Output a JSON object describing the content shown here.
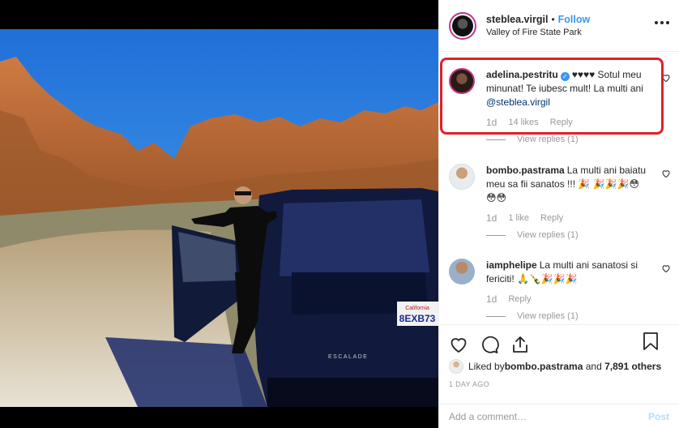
{
  "header": {
    "username": "steblea.virgil",
    "separator": "•",
    "follow_label": "Follow",
    "location": "Valley of Fire State Park",
    "more_icon": "ellipsis-icon"
  },
  "comments": [
    {
      "user": "adelina.pestritu",
      "verified": true,
      "text_prefix": "♥♥♥♥ Sotul meu minunat! Te iubesc mult! La multi ani ",
      "mention": "@steblea.virgil",
      "time": "1d",
      "likes": "14 likes",
      "reply": "Reply",
      "view_replies": "View replies (1)"
    },
    {
      "user": "bombo.pastrama",
      "text": "La multi ani baiatu meu sa fii sanatos !!! 🎉 🎉🎉🎉😳😳😳",
      "time": "1d",
      "likes": "1 like",
      "reply": "Reply",
      "view_replies": "View replies (1)"
    },
    {
      "user": "iamphelipe",
      "text": "La multi ani sanatosi si fericiti! 🙏🍾🎉🎉🎉",
      "time": "1d",
      "reply": "Reply",
      "view_replies": "View replies (1)"
    }
  ],
  "actions": {
    "like_icon": "heart-icon",
    "comment_icon": "comment-icon",
    "share_icon": "share-icon",
    "save_icon": "bookmark-icon"
  },
  "liked_by": {
    "prefix": "Liked by ",
    "user": "bombo.pastrama",
    "middle": " and ",
    "others": "7,891 others"
  },
  "time_ago": "1 DAY AGO",
  "add_comment": {
    "placeholder": "Add a comment…",
    "post_label": "Post"
  },
  "photo": {
    "plate_text": "8EXB73",
    "plate_header": "California",
    "car_badge": "ESCALADE"
  },
  "colors": {
    "link_blue": "#3897f0",
    "highlight_red": "#e0202a",
    "post_disabled": "#b2dffc"
  }
}
